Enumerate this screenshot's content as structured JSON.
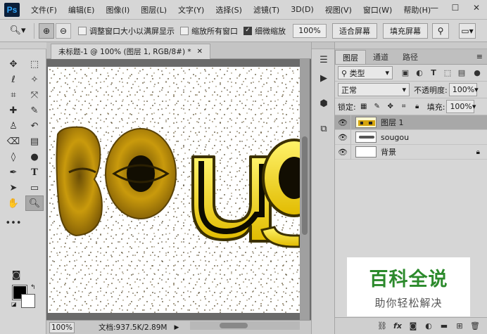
{
  "app": {
    "logo": "Ps"
  },
  "menu": [
    "文件(F)",
    "编辑(E)",
    "图像(I)",
    "图层(L)",
    "文字(Y)",
    "选择(S)",
    "滤镜(T)",
    "3D(D)",
    "视图(V)",
    "窗口(W)",
    "帮助(H)"
  ],
  "window_controls": {
    "minimize": "—",
    "maximize": "☐",
    "close": "✕"
  },
  "options": {
    "resize_windows_label": "调整窗口大小以满屏显示",
    "resize_windows_checked": false,
    "zoom_all_label": "缩放所有窗口",
    "zoom_all_checked": false,
    "scrubby_zoom_label": "细微缩放",
    "scrubby_zoom_checked": true,
    "zoom_percent": "100%",
    "fit_screen_label": "适合屏幕",
    "fill_screen_label": "填充屏幕"
  },
  "document": {
    "tab_title": "未标题-1 @ 100% (图层 1, RGB/8#) *",
    "canvas_text": "sougou",
    "canvas_background": "#ffffff",
    "text_color": "#f2d21a"
  },
  "status": {
    "zoom": "100%",
    "doc_info": "文档:937.5K/2.89M"
  },
  "layers_panel": {
    "tabs": [
      "图层",
      "通道",
      "路径"
    ],
    "active_tab": 0,
    "filter_kind": "类型",
    "blend_mode": "正常",
    "opacity_label": "不透明度:",
    "opacity_value": "100%",
    "lock_label": "锁定:",
    "fill_label": "填充:",
    "fill_value": "100%",
    "layers": [
      {
        "name": "图层 1",
        "visible": true,
        "selected": true,
        "locked": false
      },
      {
        "name": "sougou",
        "visible": true,
        "selected": false,
        "locked": false
      },
      {
        "name": "背景",
        "visible": true,
        "selected": false,
        "locked": true
      }
    ]
  },
  "watermark": {
    "title": "百科全说",
    "subtitle": "助你轻松解决",
    "color": "#2c8a2c"
  }
}
